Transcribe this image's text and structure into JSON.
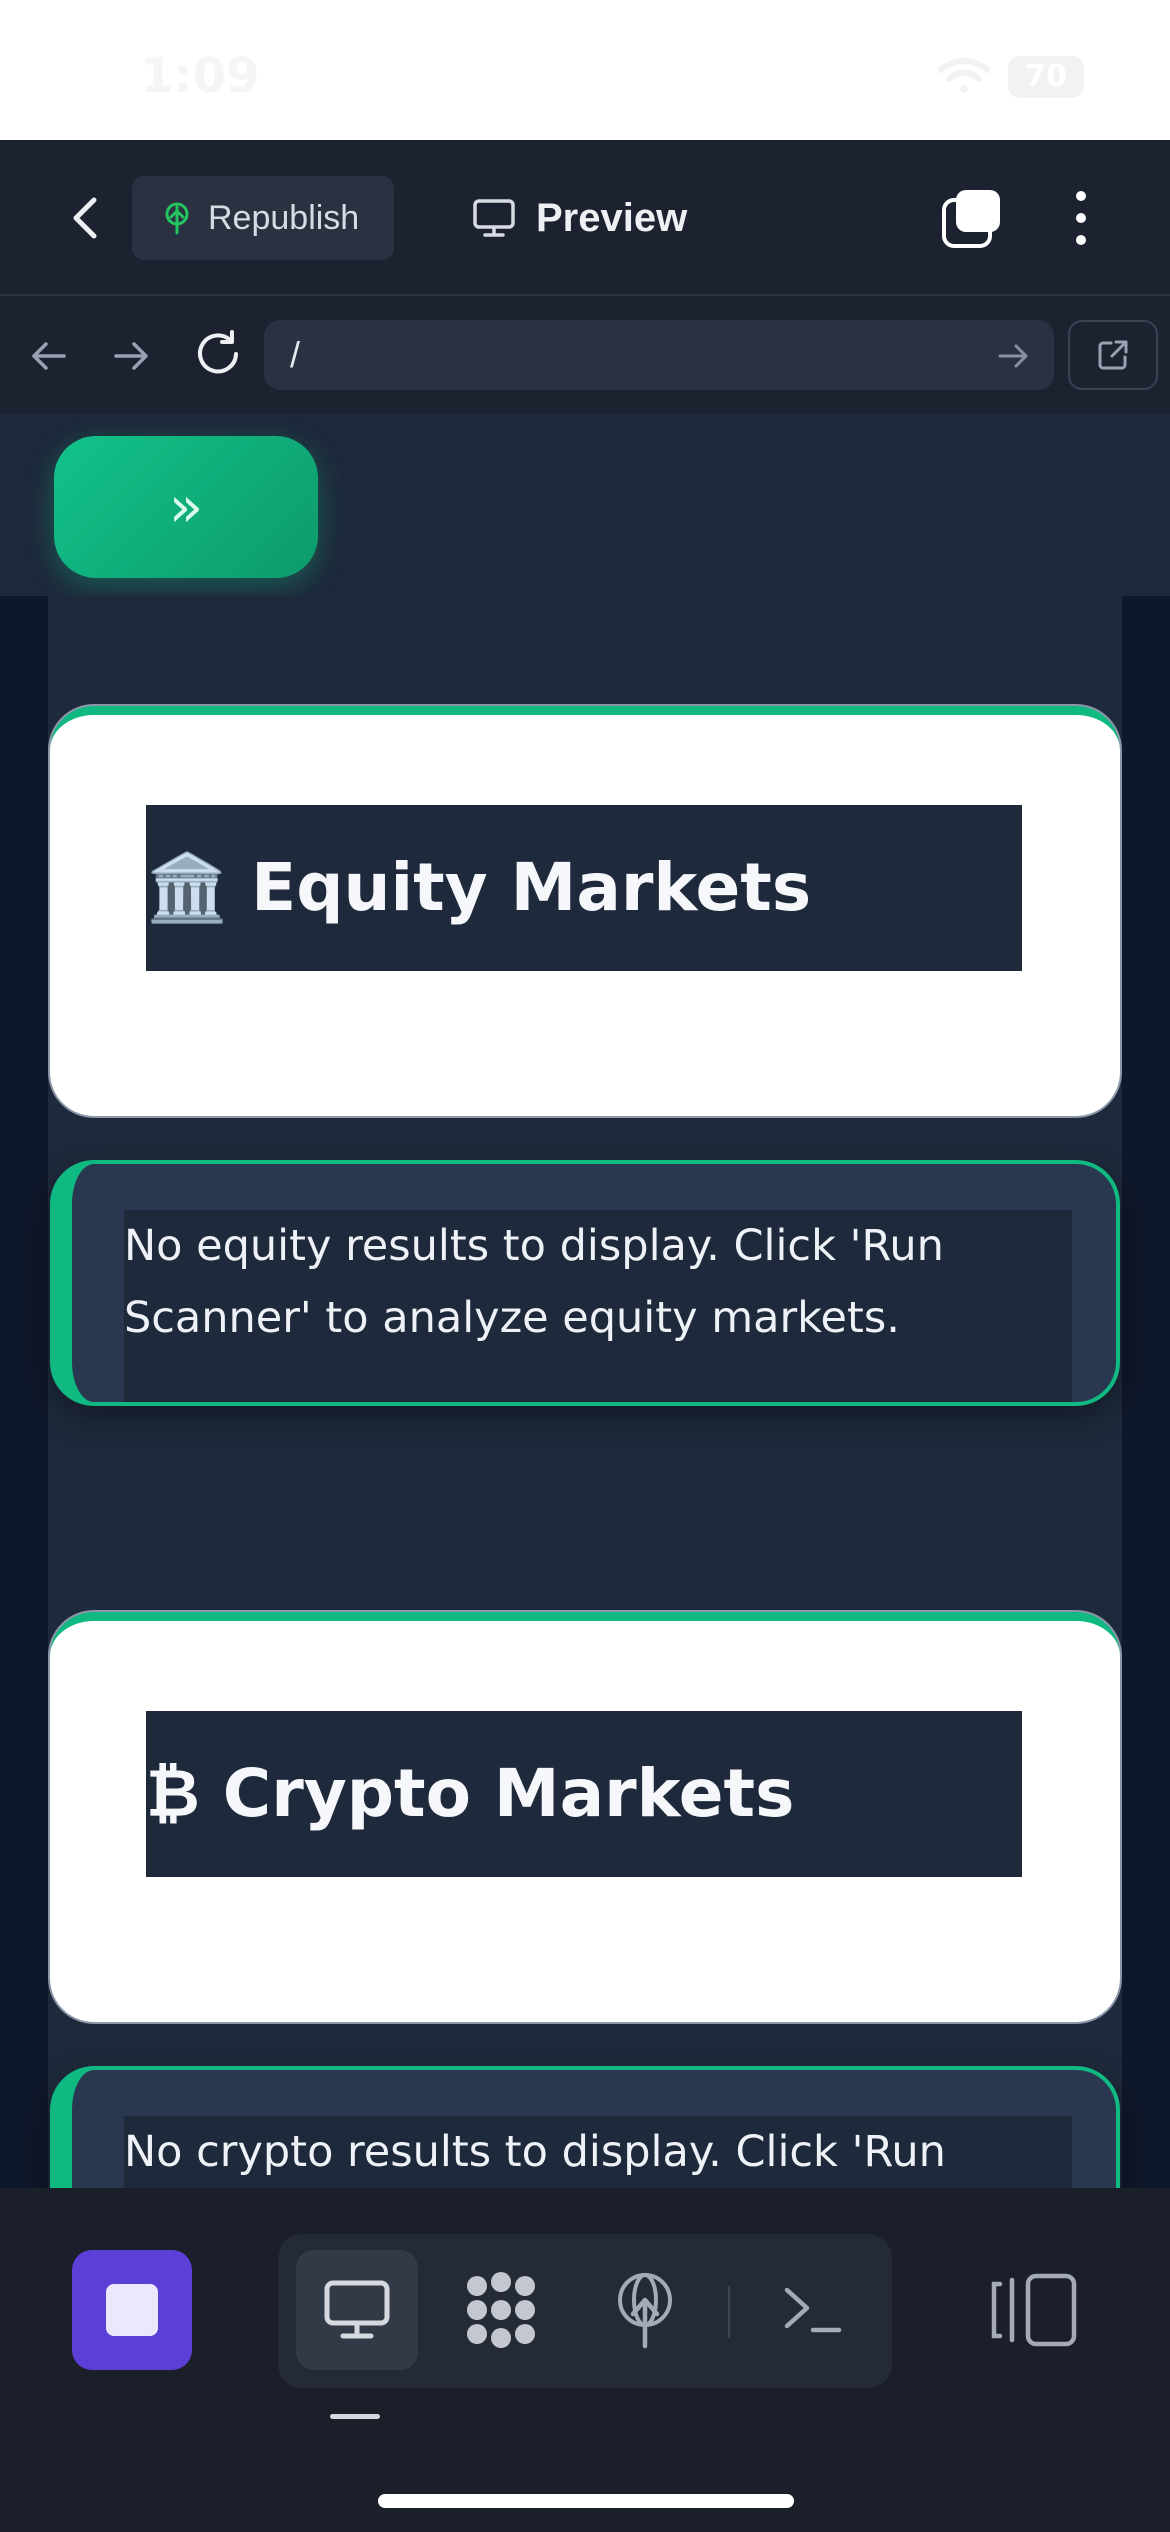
{
  "status_bar": {
    "time": "1:09",
    "battery": "70"
  },
  "toolbar": {
    "republish_label": "Republish",
    "preview_label": "Preview"
  },
  "urlbar": {
    "url": "/"
  },
  "app": {
    "sidebar_toggle_label": "»",
    "sections": [
      {
        "heading": "🏛️ Equity Markets",
        "message": "No equity results to display. Click 'Run Scanner' to analyze equity markets."
      },
      {
        "heading": "₿ Crypto Markets",
        "message": "No crypto results to display. Click 'Run"
      }
    ]
  },
  "colors": {
    "accent": "#10b981",
    "stop_button": "#5b3fd6",
    "app_bg": "#1e293b"
  },
  "bottom_bar": {
    "tabs": [
      "desktop-icon",
      "agent-icon",
      "deploy-icon",
      "terminal-icon"
    ],
    "active_tab": "desktop-icon"
  }
}
